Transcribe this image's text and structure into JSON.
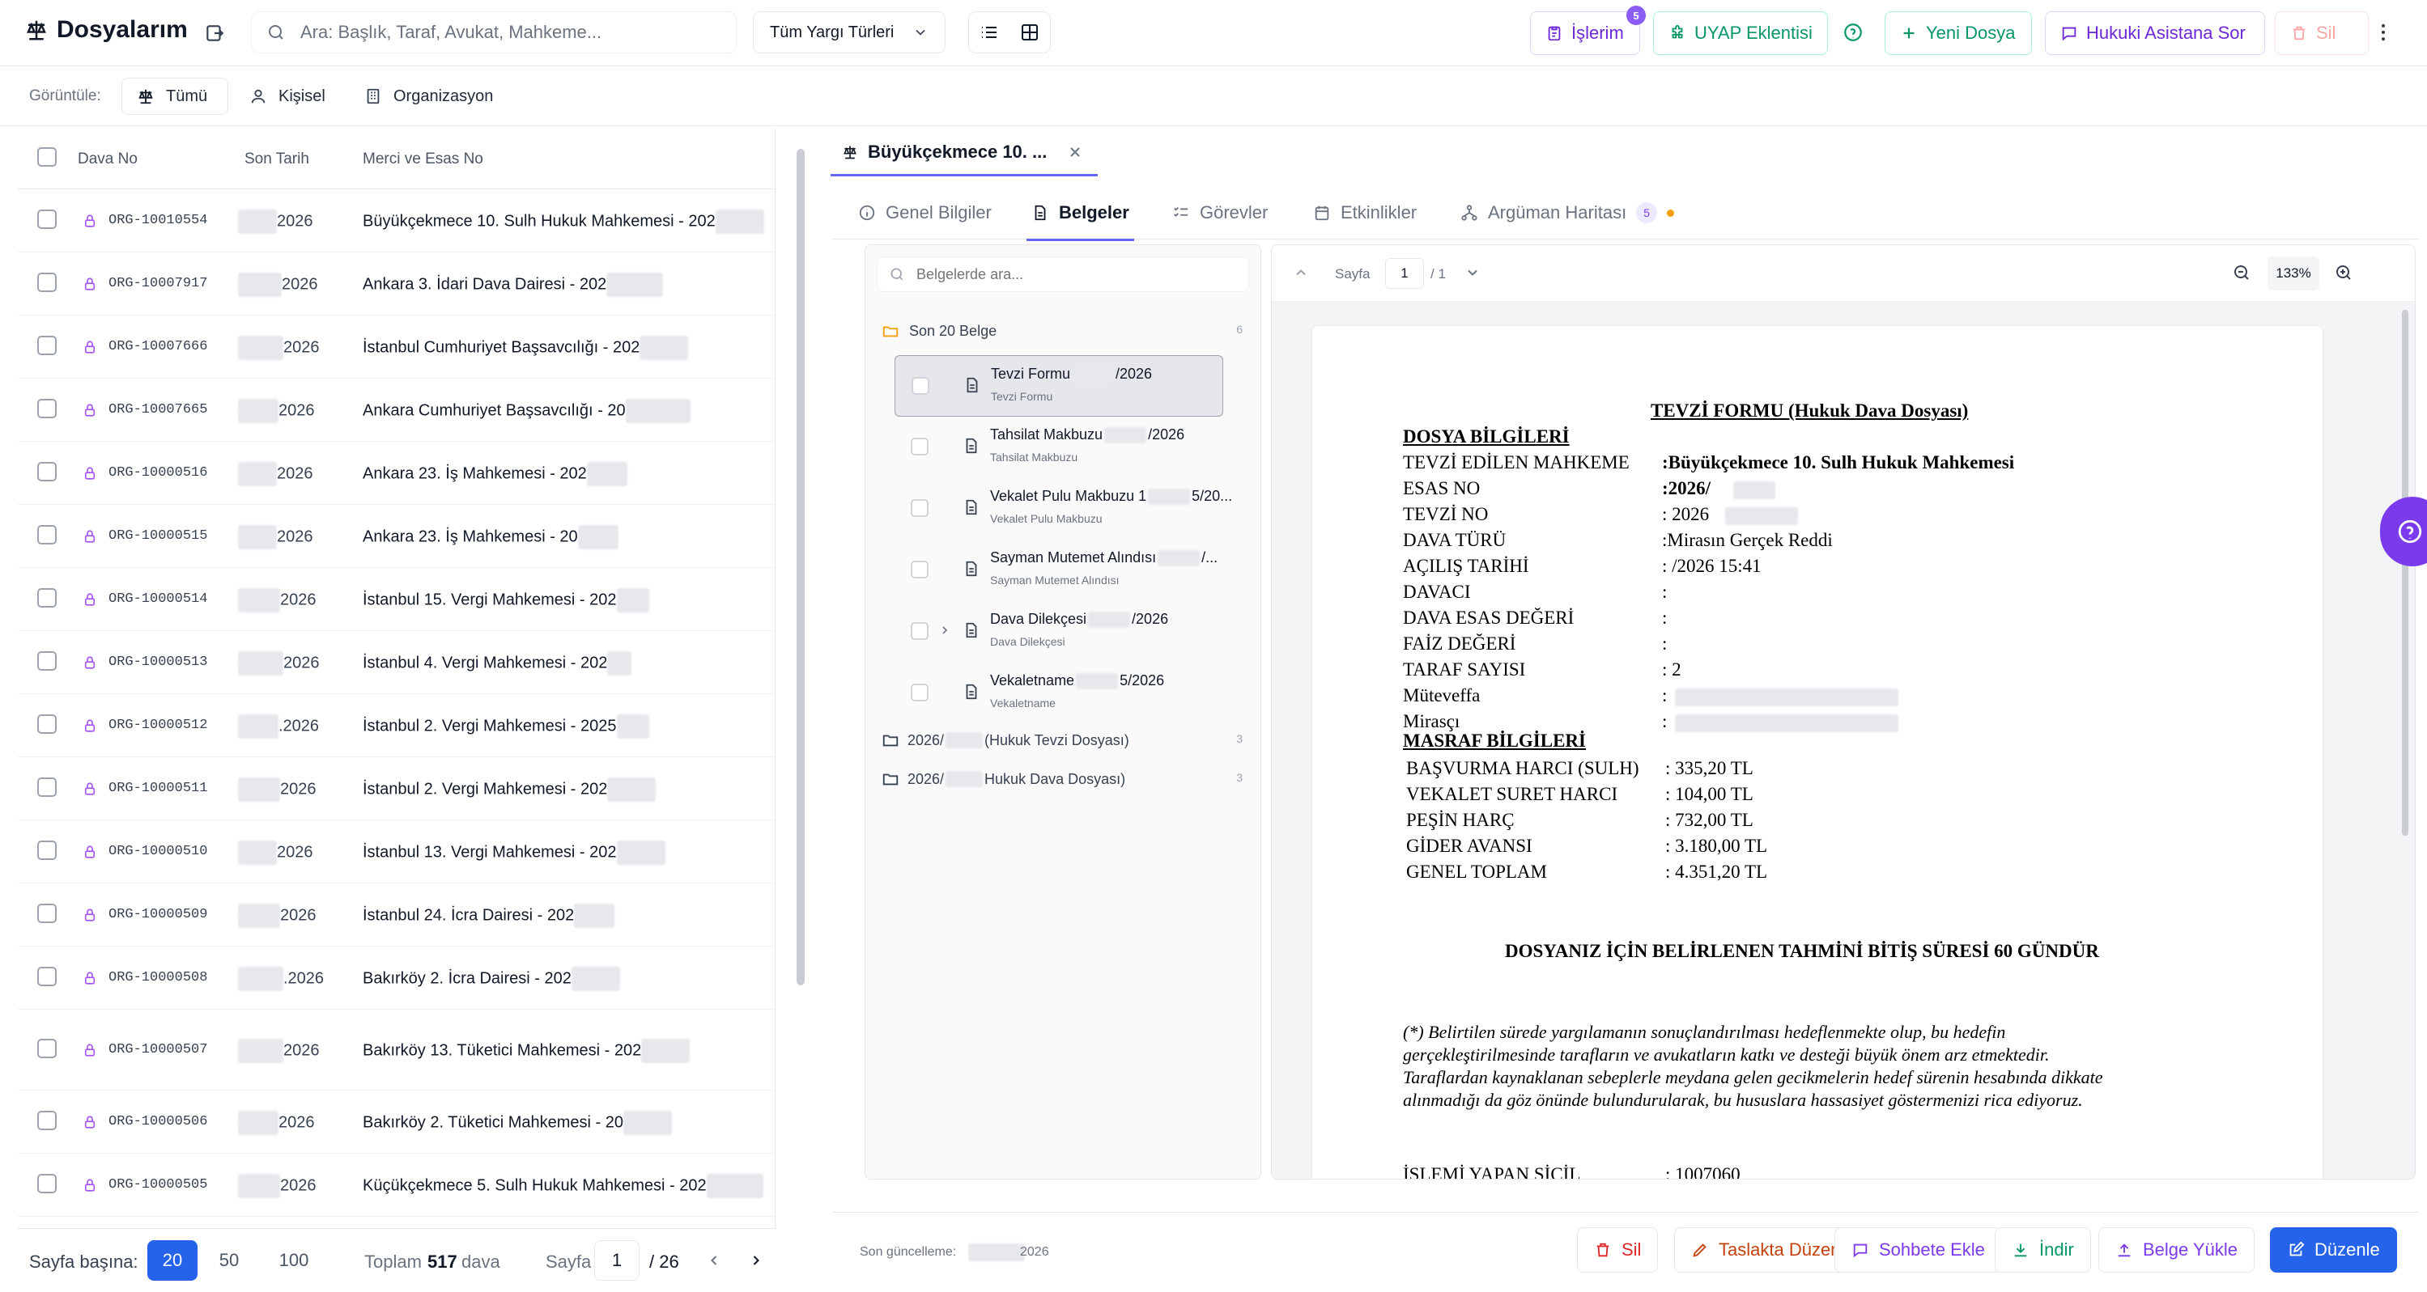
{
  "app": {
    "title": "Dosyalarım"
  },
  "search": {
    "placeholder": "Ara: Başlık, Taraf, Avukat, Mahkeme..."
  },
  "filter_select": {
    "value": "Tüm Yargı Türleri"
  },
  "toolbar": {
    "islerim_label": "İşlerim",
    "islerim_badge": "5",
    "uyap_label": "UYAP Eklentisi",
    "yeni_dosya_label": "Yeni Dosya",
    "hukuki_asistan_label": "Hukuki Asistana Sor",
    "sil_label": "Sil"
  },
  "view_filter": {
    "label": "Görüntüle:",
    "options": [
      {
        "label": "Tümü"
      },
      {
        "label": "Kişisel"
      },
      {
        "label": "Organizasyon"
      }
    ]
  },
  "table": {
    "headers": [
      "Dava No",
      "Son Tarih",
      "Merci ve Esas No"
    ],
    "rows": [
      {
        "no": "ORG-10010554",
        "date": "2026",
        "merci": "Büyükçekmece 10. Sulh Hukuk Mahkemesi - 202"
      },
      {
        "no": "ORG-10007917",
        "date": "2026",
        "merci": "Ankara 3. İdari Dava Dairesi - 202"
      },
      {
        "no": "ORG-10007666",
        "date": "2026",
        "merci": "İstanbul Cumhuriyet Başsavcılığı - 202"
      },
      {
        "no": "ORG-10007665",
        "date": "2026",
        "merci": "Ankara Cumhuriyet Başsavcılığı - 20"
      },
      {
        "no": "ORG-10000516",
        "date": "2026",
        "merci": "Ankara 23. İş Mahkemesi - 202"
      },
      {
        "no": "ORG-10000515",
        "date": "2026",
        "merci": "Ankara 23. İş Mahkemesi - 20"
      },
      {
        "no": "ORG-10000514",
        "date": "2026",
        "merci": "İstanbul 15. Vergi Mahkemesi - 202"
      },
      {
        "no": "ORG-10000513",
        "date": "2026",
        "merci": "İstanbul 4. Vergi Mahkemesi - 202"
      },
      {
        "no": "ORG-10000512",
        "date": ".2026",
        "merci": "İstanbul 2. Vergi Mahkemesi - 2025"
      },
      {
        "no": "ORG-10000511",
        "date": "2026",
        "merci": "İstanbul 2. Vergi Mahkemesi - 202"
      },
      {
        "no": "ORG-10000510",
        "date": "2026",
        "merci": "İstanbul 13. Vergi Mahkemesi - 202"
      },
      {
        "no": "ORG-10000509",
        "date": "2026",
        "merci": "İstanbul 24. İcra Dairesi - 202"
      },
      {
        "no": "ORG-10000508",
        "date": ".2026",
        "merci": "Bakırköy 2. İcra Dairesi - 202"
      },
      {
        "no": "ORG-10000507",
        "date": "2026",
        "merci": "Bakırköy 13. Tüketici Mahkemesi - 202"
      },
      {
        "no": "ORG-10000506",
        "date": "2026",
        "merci": "Bakırköy 2. Tüketici Mahkemesi - 20"
      },
      {
        "no": "ORG-10000505",
        "date": "2026",
        "merci": "Küçükçekmece 5. Sulh Hukuk Mahkemesi - 202"
      }
    ]
  },
  "pagination": {
    "per_page_label": "Sayfa başına:",
    "per_page_options": [
      "20",
      "50",
      "100"
    ],
    "total_prefix": "Toplam",
    "total_count": "517",
    "total_suffix": "dava",
    "page_label": "Sayfa",
    "page_value": "1",
    "page_total": "/ 26"
  },
  "file_tab": {
    "title": "Büyükçekmece 10. ..."
  },
  "tabs": [
    {
      "label": "Genel Bilgiler"
    },
    {
      "label": "Belgeler"
    },
    {
      "label": "Görevler"
    },
    {
      "label": "Etkinlikler"
    },
    {
      "label": "Argüman Haritası",
      "badge": "5"
    }
  ],
  "documents": {
    "search_placeholder": "Belgelerde ara...",
    "recent_label": "Son 20 Belge",
    "recent_count": "6",
    "items": [
      {
        "title": "Tevzi Formu",
        "suffix": "/2026",
        "subtitle": "Tevzi Formu"
      },
      {
        "title": "Tahsilat Makbuzu",
        "suffix": "/2026",
        "subtitle": "Tahsilat Makbuzu"
      },
      {
        "title": "Vekalet Pulu Makbuzu 1",
        "suffix": "5/20...",
        "subtitle": "Vekalet Pulu Makbuzu"
      },
      {
        "title": "Sayman Mutemet Alındısı",
        "suffix": "/...",
        "subtitle": "Sayman Mutemet Alındısı"
      },
      {
        "title": "Dava Dilekçesi",
        "suffix": "/2026",
        "subtitle": "Dava Dilekçesi"
      },
      {
        "title": "Vekaletname",
        "suffix": "5/2026",
        "subtitle": "Vekaletname"
      }
    ],
    "folders": [
      {
        "prefix": "2026/",
        "label": "(Hukuk Tevzi Dosyası)",
        "count": "3"
      },
      {
        "prefix": "2026/",
        "label": "Hukuk Dava Dosyası)",
        "count": "3"
      }
    ]
  },
  "viewer": {
    "page_label": "Sayfa",
    "page_value": "1",
    "page_total": "/ 1",
    "zoom": "133%"
  },
  "document": {
    "title": "TEVZİ FORMU (Hukuk Dava Dosyası)",
    "section1": "DOSYA BİLGİLERİ",
    "fields": [
      {
        "label": "TEVZİ EDİLEN MAHKEME",
        "value": ":Büyükçekmece 10. Sulh Hukuk Mahkemesi"
      },
      {
        "label": "ESAS NO",
        "value": ":2026/"
      },
      {
        "label": "TEVZİ NO",
        "value": ": 2026"
      },
      {
        "label": "DAVA TÜRÜ",
        "value": ":Mirasın Gerçek Reddi"
      },
      {
        "label": "AÇILIŞ TARİHİ",
        "value": ":          /2026  15:41"
      },
      {
        "label": "DAVACI",
        "value": ":"
      },
      {
        "label": "DAVA ESAS DEĞERİ",
        "value": ":"
      },
      {
        "label": "FAİZ DEĞERİ",
        "value": ":"
      },
      {
        "label": "TARAF SAYISI",
        "value": ": 2"
      },
      {
        "label": "Müteveffa",
        "value": ":"
      },
      {
        "label": "Mirasçı",
        "value": ":"
      }
    ],
    "section2": "MASRAF BİLGİLERİ",
    "costs": [
      {
        "label": "BAŞVURMA HARCI (SULH)",
        "value": ": 335,20 TL"
      },
      {
        "label": "VEKALET SURET HARCI",
        "value": ": 104,00 TL"
      },
      {
        "label": "PEŞİN HARÇ",
        "value": ": 732,00 TL"
      },
      {
        "label": "GİDER AVANSI",
        "value": ": 3.180,00 TL"
      },
      {
        "label": "GENEL TOPLAM",
        "value": ": 4.351,20 TL"
      }
    ],
    "deadline": "DOSYANIZ İÇİN BELİRLENEN TAHMİNİ BİTİŞ SÜRESİ 60 GÜNDÜR",
    "note": [
      "(*) Belirtilen sürede yargılamanın sonuçlandırılması hedeflenmekte olup, bu hedefin",
      "gerçekleştirilmesinde tarafların ve avukatların katkı ve desteği büyük önem arz etmektedir.",
      "Taraflardan kaynaklanan sebeplerle meydana gelen gecikmelerin hedef sürenin hesabında dikkate",
      "alınmadığı da göz önünde bulundurularak, bu hususlara hassasiyet göstermenizi rica ediyoruz."
    ],
    "cut_label": "İŞLEMİ YAPAN SİCİL",
    "cut_value": ": 1007060"
  },
  "bottom": {
    "updated_label": "Son güncelleme:",
    "updated_value": "2026",
    "sil_label": "Sil",
    "taslak_label": "Taslakta Düzenle",
    "sohbet_label": "Sohbete Ekle",
    "indir_label": "İndir",
    "yukle_label": "Belge Yükle",
    "duzenle_label": "Düzenle"
  },
  "colors": {
    "accent": "#4f46e5",
    "purple": "#7c3aed",
    "green": "#10b981",
    "danger": "#dc2626",
    "primary_button": "#2563eb"
  }
}
